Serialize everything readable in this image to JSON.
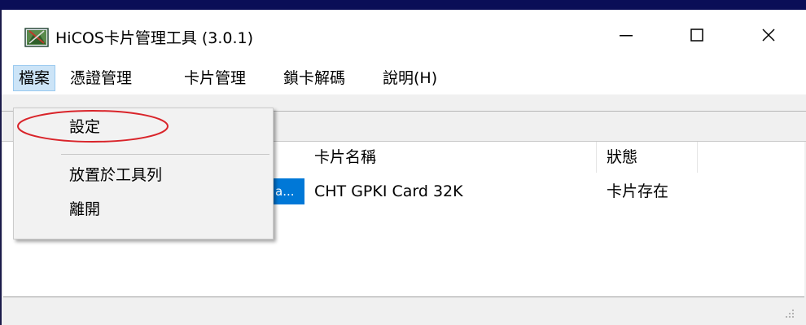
{
  "window": {
    "title": "HiCOS卡片管理工具 (3.0.1)",
    "app_icon": "hicos-app-icon",
    "controls": {
      "minimize": "minimize-icon",
      "maximize": "maximize-icon",
      "close": "close-icon"
    }
  },
  "menubar": {
    "items": [
      {
        "label": "檔案",
        "active": true
      },
      {
        "label": "憑證管理"
      },
      {
        "label": "卡片管理"
      },
      {
        "label": "鎖卡解碼"
      },
      {
        "label": "說明(H)"
      }
    ]
  },
  "file_menu": {
    "items": [
      {
        "label": "設定"
      },
      {
        "label": "放置於工具列"
      },
      {
        "label": "離開"
      }
    ]
  },
  "card_list": {
    "columns": [
      {
        "label": "卡片名稱"
      },
      {
        "label": "狀態"
      }
    ],
    "rows": [
      {
        "reader": "a...",
        "card_name": "CHT GPKI Card 32K",
        "status": "卡片存在"
      }
    ]
  },
  "colors": {
    "selection": "#0078d7",
    "menu_active": "#cce4f7",
    "annotation": "#d9242a"
  }
}
